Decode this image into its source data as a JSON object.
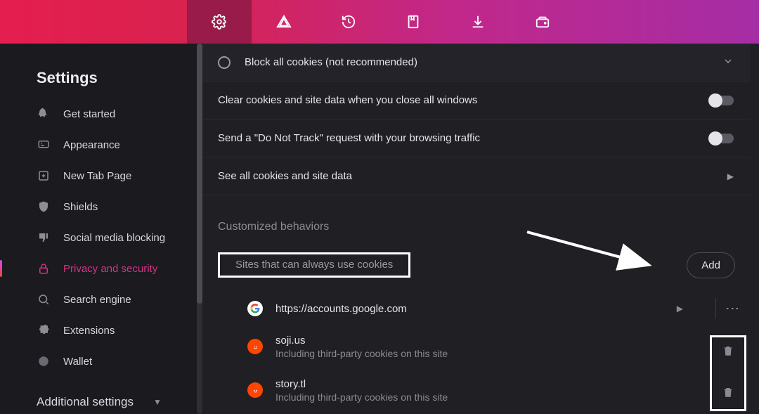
{
  "sidebar": {
    "title": "Settings",
    "items": [
      {
        "label": "Get started"
      },
      {
        "label": "Appearance"
      },
      {
        "label": "New Tab Page"
      },
      {
        "label": "Shields"
      },
      {
        "label": "Social media blocking"
      },
      {
        "label": "Privacy and security"
      },
      {
        "label": "Search engine"
      },
      {
        "label": "Extensions"
      },
      {
        "label": "Wallet"
      }
    ],
    "additional": "Additional settings"
  },
  "content": {
    "block_all": "Block all cookies (not recommended)",
    "clear_on_close": "Clear cookies and site data when you close all windows",
    "dnt": "Send a \"Do Not Track\" request with your browsing traffic",
    "see_all": "See all cookies and site data",
    "customized": "Customized behaviors",
    "sites_always": "Sites that can always use cookies",
    "add": "Add",
    "sites": [
      {
        "url": "https://accounts.google.com",
        "sub": ""
      },
      {
        "url": "soji.us",
        "sub": "Including third-party cookies on this site"
      },
      {
        "url": "story.tl",
        "sub": "Including third-party cookies on this site"
      }
    ]
  }
}
